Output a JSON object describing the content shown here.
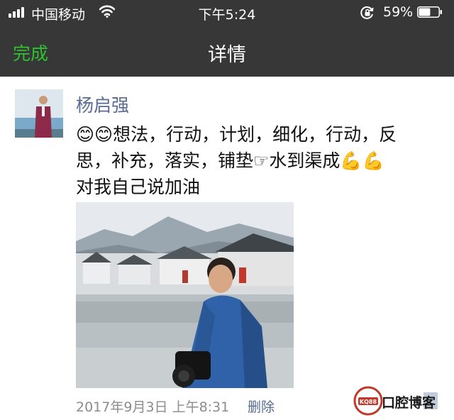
{
  "status_bar": {
    "carrier": "中国移动",
    "time": "下午5:24",
    "battery_percent": "59%",
    "battery_level": 0.59,
    "icons": [
      "signal-icon",
      "wifi-icon",
      "orientation-lock-icon",
      "battery-icon"
    ]
  },
  "nav": {
    "done_label": "完成",
    "title": "详情"
  },
  "post": {
    "username": "杨启强",
    "text_line1": "😊😊想法，行动，计划，细化，行动，反",
    "text_line2": "思，补充，落实，铺垫☞水到渠成💪💪",
    "text_line3": "对我自己说加油",
    "timestamp": "2017年9月3日 上午8:31",
    "delete_label": "删除"
  },
  "watermark": {
    "badge": "KQ88",
    "text": "口腔博客"
  },
  "colors": {
    "nav_background": "#373737",
    "done_green": "#2ec22e",
    "link_blue": "#586b95",
    "meta_gray": "#8c8c8c"
  }
}
